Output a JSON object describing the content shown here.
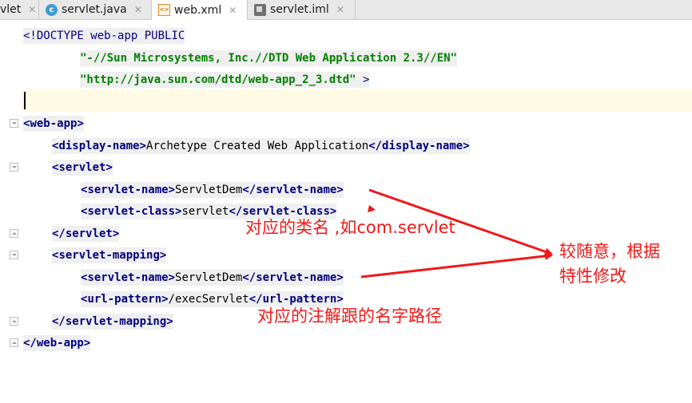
{
  "tabs": [
    {
      "label": "vlet",
      "icon": "none",
      "active": false
    },
    {
      "label": "servlet.java",
      "icon": "java-class-icon",
      "active": false
    },
    {
      "label": "web.xml",
      "icon": "xml-file-icon",
      "active": true
    },
    {
      "label": "servlet.iml",
      "icon": "module-file-icon",
      "active": false
    }
  ],
  "tab_close_glyph": "✕",
  "icon_glyphs": {
    "java": "c",
    "xml": "<>"
  },
  "code": {
    "l1_doctype": "<!DOCTYPE",
    "l1_root": "web-app",
    "l1_public": "PUBLIC",
    "l2_public_id": "\"-//Sun Microsystems, Inc.//DTD Web Application 2.3//EN\"",
    "l3_system_id": "\"http://java.sun.com/dtd/web-app_2_3.dtd\"",
    "l3_end": ">",
    "web_app": "web-app",
    "display_name": "display-name",
    "display_name_value": "Archetype Created Web Application",
    "servlet": "servlet",
    "servlet_name": "servlet-name",
    "servlet_name_value": "ServletDem",
    "servlet_class": "servlet-class",
    "servlet_class_value": "servlet",
    "servlet_mapping": "servlet-mapping",
    "url_pattern": "url-pattern",
    "url_pattern_value": "/execServlet"
  },
  "annotations": {
    "class_note": "对应的类名 ,如com.servlet",
    "flexible_note_line1": "较随意，根据",
    "flexible_note_line2": "特性修改",
    "path_note": "对应的注解跟的名字路径"
  },
  "colors": {
    "tag": "#000080",
    "string": "#008000",
    "annotation": "#f01818",
    "caret_line": "#fffae3",
    "tab_bar": "#e8e8e8"
  }
}
